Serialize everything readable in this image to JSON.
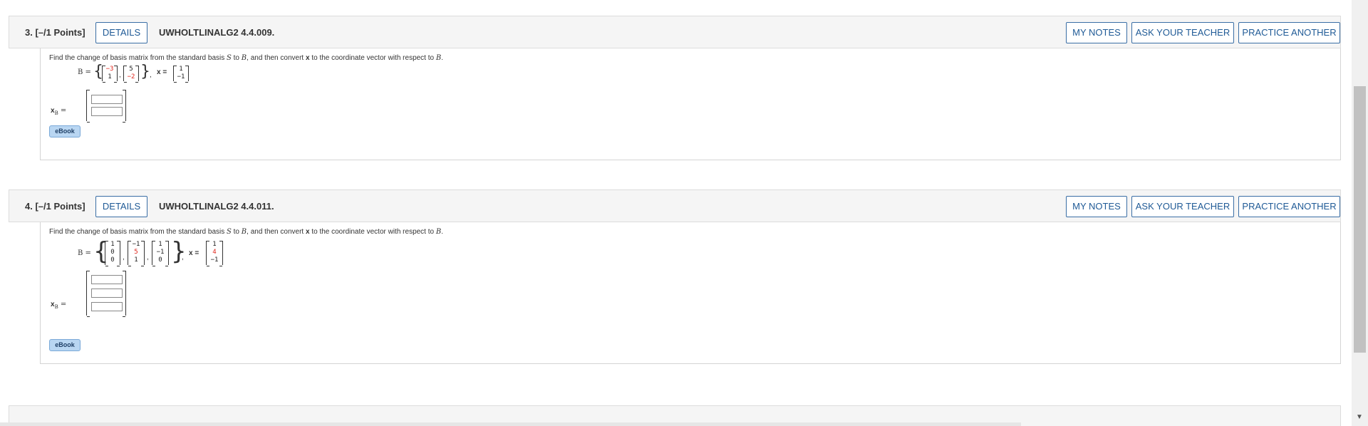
{
  "questions": [
    {
      "number": "3.",
      "points": "[–/1 Points]",
      "details_label": "DETAILS",
      "id": "UWHOLTLINALG2 4.4.009.",
      "my_notes_label": "MY NOTES",
      "ask_teacher_label": "ASK YOUR TEACHER",
      "practice_label": "PRACTICE ANOTHER",
      "prompt_a": "Find the change of basis matrix from the standard basis ",
      "prompt_s": "S",
      "prompt_b": " to ",
      "prompt_B": "B",
      "prompt_c": ", and then convert ",
      "prompt_x": "x",
      "prompt_d": " to the coordinate vector with respect to ",
      "prompt_B2": "B",
      "prompt_e": ".",
      "basis_label": "B = ",
      "basis_vectors": [
        [
          "−3",
          "1"
        ],
        [
          "5",
          "−2"
        ]
      ],
      "x_label": "x = ",
      "x_vector": [
        "1",
        "−1"
      ],
      "answer_label": "x",
      "answer_sub": "B",
      "answer_eq": " =",
      "ebook_label": "eBook"
    },
    {
      "number": "4.",
      "points": "[–/1 Points]",
      "details_label": "DETAILS",
      "id": "UWHOLTLINALG2 4.4.011.",
      "my_notes_label": "MY NOTES",
      "ask_teacher_label": "ASK YOUR TEACHER",
      "practice_label": "PRACTICE ANOTHER",
      "prompt_a": "Find the change of basis matrix from the standard basis ",
      "prompt_s": "S",
      "prompt_b": " to ",
      "prompt_B": "B",
      "prompt_c": ", and then convert ",
      "prompt_x": "x",
      "prompt_d": " to the coordinate vector with respect to ",
      "prompt_B2": "B",
      "prompt_e": ".",
      "basis_label": "B = ",
      "basis_vectors": [
        [
          "1",
          "0",
          "0"
        ],
        [
          "−1",
          "5",
          "1"
        ],
        [
          "1",
          "−1",
          "0"
        ]
      ],
      "x_label": "x = ",
      "x_vector": [
        "1",
        "4",
        "−1"
      ],
      "answer_label": "x",
      "answer_sub": "B",
      "answer_eq": " =",
      "ebook_label": "eBook"
    }
  ],
  "colors": {
    "accent": "#1f5a96",
    "highlight_red": "#e0261c",
    "header_bg": "#f5f5f5"
  }
}
